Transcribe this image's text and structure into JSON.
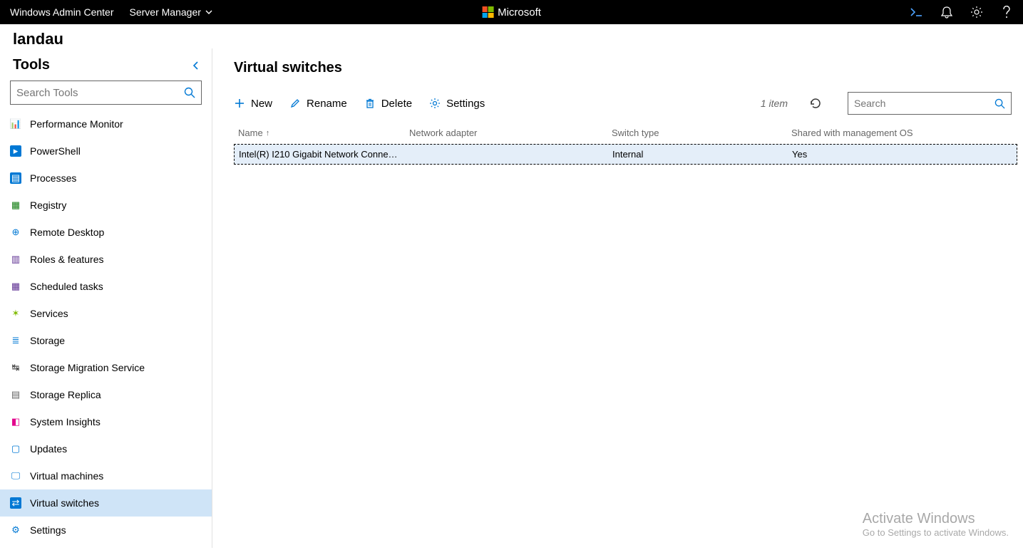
{
  "topbar": {
    "title": "Windows Admin Center",
    "dropdown": "Server Manager",
    "brand": "Microsoft"
  },
  "breadcrumb": {
    "server": "landau"
  },
  "sidebar": {
    "title": "Tools",
    "search_placeholder": "Search Tools",
    "items": [
      {
        "label": "Performance Monitor"
      },
      {
        "label": "PowerShell"
      },
      {
        "label": "Processes"
      },
      {
        "label": "Registry"
      },
      {
        "label": "Remote Desktop"
      },
      {
        "label": "Roles & features"
      },
      {
        "label": "Scheduled tasks"
      },
      {
        "label": "Services"
      },
      {
        "label": "Storage"
      },
      {
        "label": "Storage Migration Service"
      },
      {
        "label": "Storage Replica"
      },
      {
        "label": "System Insights"
      },
      {
        "label": "Updates"
      },
      {
        "label": "Virtual machines"
      },
      {
        "label": "Virtual switches"
      },
      {
        "label": "Settings"
      }
    ],
    "active_index": 14
  },
  "content": {
    "title": "Virtual switches",
    "toolbar": {
      "new": "New",
      "rename": "Rename",
      "delete": "Delete",
      "settings": "Settings",
      "count": "1 item",
      "search_placeholder": "Search"
    },
    "columns": {
      "name": "Name",
      "network_adapter": "Network adapter",
      "switch_type": "Switch type",
      "shared": "Shared with management OS"
    },
    "rows": [
      {
        "name": "Intel(R) I210 Gigabit Network Connectio...",
        "adapter": "",
        "type": "Internal",
        "shared": "Yes"
      }
    ]
  },
  "watermark": {
    "title": "Activate Windows",
    "sub": "Go to Settings to activate Windows."
  }
}
